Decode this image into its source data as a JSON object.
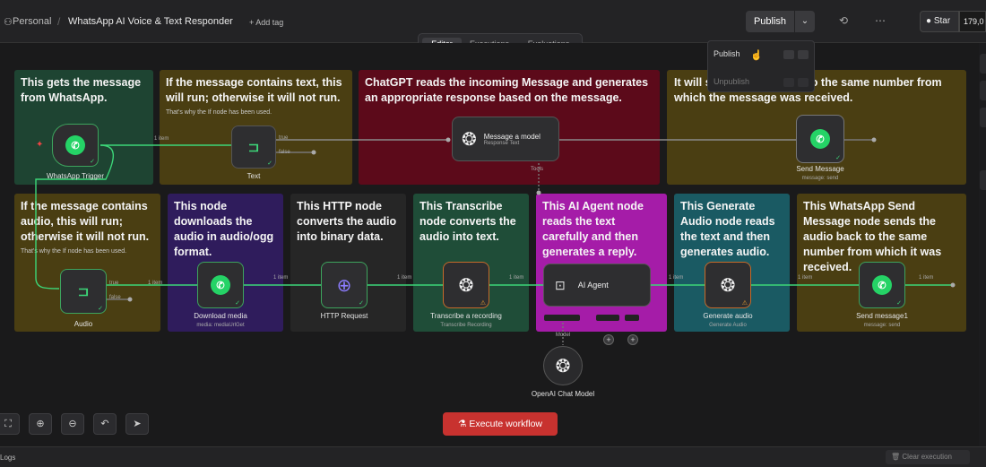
{
  "header": {
    "project": "Personal",
    "workflow_name": "WhatsApp AI Voice & Text Responder",
    "add_tag": "+ Add tag",
    "publish_label": "Publish",
    "star_label": "Star",
    "star_count": "179,0"
  },
  "modes": [
    "Editor",
    "Executions",
    "Evaluations"
  ],
  "publish_menu": {
    "publish": "Publish",
    "unpublish": "Unpublish"
  },
  "sticky_notes": [
    {
      "text": "This gets the message from WhatsApp.",
      "sub": ""
    },
    {
      "text": "If the message contains text, this will run; otherwise it will not run.",
      "sub": "That's why the If node has been used."
    },
    {
      "text": "ChatGPT reads the incoming Message and generates an appropriate response based on the message.",
      "sub": ""
    },
    {
      "text": "It will send the response to the same number from which the message was received.",
      "sub": ""
    },
    {
      "text": "If the message contains audio, this will run; otherwise it will not run.",
      "sub": "That's why the If node has been used."
    },
    {
      "text": "This node downloads the audio in audio/ogg format.",
      "sub": ""
    },
    {
      "text": "This HTTP node converts the audio into binary data.",
      "sub": ""
    },
    {
      "text": "This Transcribe node converts the audio into text.",
      "sub": ""
    },
    {
      "text": "This AI Agent node reads the text carefully and then generates a reply.",
      "sub": ""
    },
    {
      "text": "This Generate Audio node reads the text and then generates audio.",
      "sub": ""
    },
    {
      "text": "This WhatsApp Send Message node sends the audio back to the same number from which it was received.",
      "sub": ""
    }
  ],
  "nodes": {
    "trigger": {
      "label": "WhatsApp Trigger",
      "icon": "whatsapp-icon"
    },
    "text_if": {
      "label": "Text",
      "icon": "if-icon",
      "true": "true",
      "false": "false"
    },
    "message_model": {
      "label": "Message a model",
      "sub": "Response Text",
      "icon": "openai-icon"
    },
    "send_message": {
      "label": "Send Message",
      "sub": "message: send",
      "icon": "whatsapp-icon"
    },
    "audio_if": {
      "label": "Audio",
      "icon": "if-icon",
      "true": "true",
      "false": "false"
    },
    "download_media": {
      "label": "Download media",
      "sub": "media: mediaUrlGet",
      "icon": "whatsapp-icon"
    },
    "http_request": {
      "label": "HTTP Request",
      "icon": "globe-icon"
    },
    "transcribe": {
      "label": "Transcribe a recording",
      "sub": "Transcribe Recording",
      "icon": "openai-icon"
    },
    "ai_agent": {
      "label": "AI Agent",
      "icon": "robot-icon"
    },
    "generate_audio": {
      "label": "Generate audio",
      "sub": "Generate Audio",
      "icon": "openai-icon"
    },
    "send_message1": {
      "label": "Send message1",
      "sub": "message: send",
      "icon": "whatsapp-icon"
    },
    "chat_model": {
      "label": "OpenAI Chat Model",
      "sub": "Model",
      "icon": "openai-icon"
    }
  },
  "connection_labels": {
    "one_item": "1 item",
    "tools": "Tools"
  },
  "toolbar": {
    "execute_label": "Execute workflow",
    "logs_label": "Logs",
    "clear_label": "Clear execution"
  },
  "colors": {
    "accent_red": "#c8322f",
    "connection_green": "#3cd678",
    "whatsapp_green": "#25d366"
  }
}
